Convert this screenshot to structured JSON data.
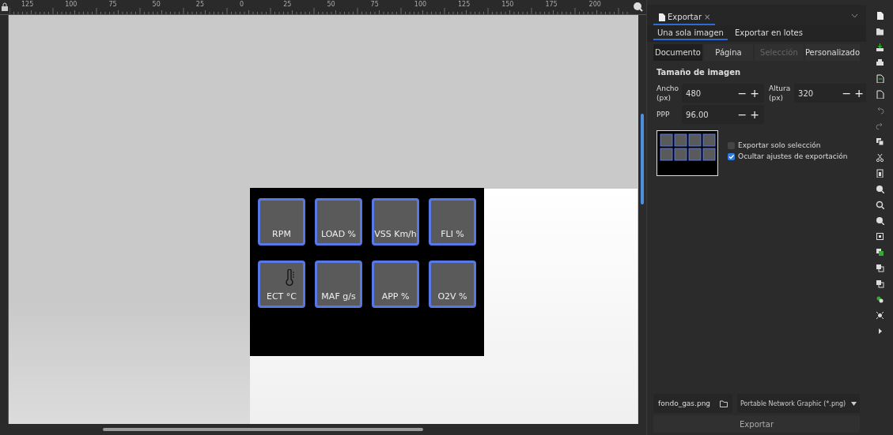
{
  "ruler": {
    "top_labels": [
      "125",
      "100",
      "75",
      "50",
      "25",
      "0",
      "25",
      "50",
      "75",
      "100",
      "125",
      "150",
      "175",
      "200"
    ]
  },
  "canvas": {
    "tiles": [
      {
        "label": "RPM",
        "kind": "plain"
      },
      {
        "label": "LOAD %",
        "kind": "plain"
      },
      {
        "label": "VSS Km/h",
        "kind": "plain"
      },
      {
        "label": "FLI %",
        "kind": "plain"
      },
      {
        "label": "ECT °C",
        "kind": "thermometer"
      },
      {
        "label": "MAF g/s",
        "kind": "plain"
      },
      {
        "label": "APP %",
        "kind": "plain"
      },
      {
        "label": "O2V %",
        "kind": "plain"
      }
    ]
  },
  "panel": {
    "tab": {
      "title": "Exportar",
      "close": "×"
    },
    "mode_tabs": [
      {
        "label": "Una sola imagen",
        "selected": true
      },
      {
        "label": "Exportar en lotes",
        "selected": false
      }
    ],
    "area_tabs": [
      {
        "label": "Documento",
        "selected": true,
        "disabled": false
      },
      {
        "label": "Página",
        "selected": false,
        "disabled": false
      },
      {
        "label": "Selección",
        "selected": false,
        "disabled": true
      },
      {
        "label": "Personalizado",
        "selected": false,
        "disabled": false
      }
    ],
    "section_title": "Tamaño de imagen",
    "fields": [
      {
        "label": "Ancho (px)",
        "value": "480",
        "steppers": [
          "−",
          "+"
        ]
      },
      {
        "label": "Altura (px)",
        "value": "320",
        "steppers": [
          "−",
          "+"
        ]
      },
      {
        "label": "PPP",
        "value": "96.00",
        "steppers": [
          "−",
          "+"
        ]
      }
    ],
    "checkboxes": [
      {
        "label": "Exportar solo selección",
        "checked": false
      },
      {
        "label": "Ocultar ajustes de exportación",
        "checked": true
      }
    ],
    "filename": "fondo_gas.png",
    "format": "Portable Network Graphic (*.png)",
    "export_button": "Exportar"
  }
}
